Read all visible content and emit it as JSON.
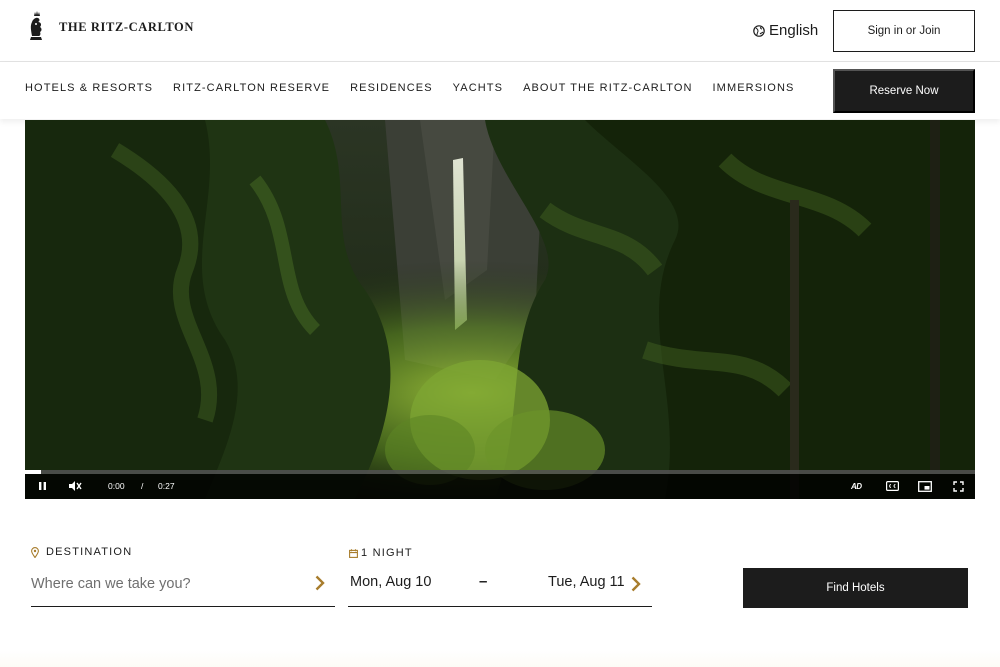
{
  "header": {
    "brand": "THE RITZ-CARLTON",
    "language": "English",
    "signin_label": "Sign in or Join"
  },
  "nav": {
    "items": [
      {
        "label": "HOTELS & RESORTS"
      },
      {
        "label": "RITZ-CARLTON RESERVE"
      },
      {
        "label": "RESIDENCES"
      },
      {
        "label": "YACHTS"
      },
      {
        "label": "ABOUT THE RITZ-CARLTON"
      },
      {
        "label": "IMMERSIONS"
      }
    ],
    "reserve_label": "Reserve Now"
  },
  "video": {
    "current_time": "0:00",
    "separator": "/",
    "duration": "0:27",
    "progress_fraction": 0.017,
    "ad_label": "AD",
    "icons": [
      "pause-icon",
      "muted-icon",
      "audio-description-icon",
      "closed-captions-icon",
      "picture-in-picture-icon",
      "fullscreen-icon"
    ]
  },
  "booking": {
    "destination_label": "DESTINATION",
    "destination_placeholder": "Where can we take you?",
    "nights_label": "1 NIGHT",
    "checkin": "Mon, Aug 10",
    "dash": "–",
    "checkout": "Tue, Aug 11",
    "find_label": "Find Hotels"
  },
  "colors": {
    "ink": "#1c1c1c",
    "accent_gold": "#a87d2d",
    "white": "#ffffff"
  }
}
